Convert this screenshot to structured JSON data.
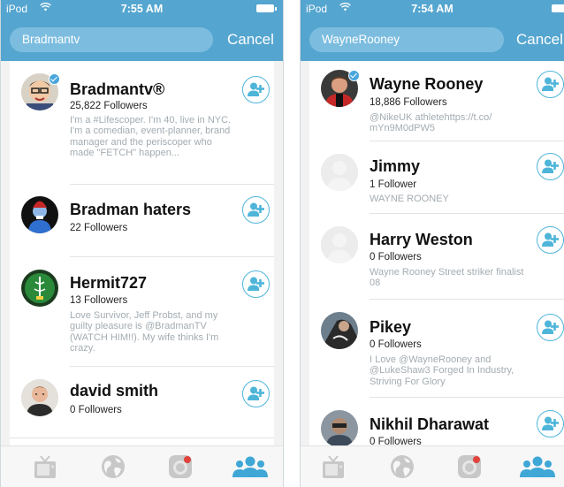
{
  "left": {
    "status": {
      "carrier": "iPod",
      "time": "7:55 AM"
    },
    "search": {
      "query": "Bradmantv",
      "cancel_label": "Cancel"
    },
    "results": [
      {
        "name": "Bradmantv®",
        "followers": "25,822 Followers",
        "verified": true,
        "bio": "I'm a #Lifescoper. I'm 40, live in NYC.  I'm a comedian, event-planner, brand manager and the periscoper who made \"FETCH\" happen..."
      },
      {
        "name": "Bradman haters",
        "followers": "22 Followers",
        "verified": false,
        "bio": ""
      },
      {
        "name": "Hermit727",
        "followers": "13 Followers",
        "verified": false,
        "bio": "Love Survivor, Jeff Probst, and my guilty pleasure is @BradmanTV (WATCH HIM!!). My wife thinks I'm crazy."
      },
      {
        "name": "david smith",
        "followers": "0 Followers",
        "verified": false,
        "bio": ""
      }
    ]
  },
  "right": {
    "status": {
      "carrier": "iPod",
      "time": "7:54 AM"
    },
    "search": {
      "query": "WayneRooney",
      "cancel_label": "Cancel"
    },
    "results": [
      {
        "name": "Wayne Rooney",
        "followers": "18,886 Followers",
        "verified": true,
        "bio": "@NikeUK athletehttps://t.co/ mYn9M0dPW5"
      },
      {
        "name": "Jimmy",
        "followers": "1 Follower",
        "verified": false,
        "bio": "WAYNE ROONEY"
      },
      {
        "name": "Harry Weston",
        "followers": "0 Followers",
        "verified": false,
        "bio": "Wayne Rooney Street striker finalist 08"
      },
      {
        "name": "Pikey",
        "followers": "0 Followers",
        "verified": false,
        "bio": "I Love @WayneRooney and @LukeShaw3 Forged In Industry, Striving For Glory"
      },
      {
        "name": "Nikhil Dharawat",
        "followers": "0 Followers",
        "verified": false,
        "bio": ""
      }
    ]
  },
  "tabs": [
    {
      "icon": "tv-icon"
    },
    {
      "icon": "globe-icon"
    },
    {
      "icon": "camera-broadcast-icon"
    },
    {
      "icon": "people-icon",
      "active": true
    }
  ],
  "colors": {
    "header": "#54a5cf",
    "search_field": "#7cbddf",
    "accent": "#4eb5d9",
    "bio_text": "#a3acb2",
    "tab_inactive": "#c8c8c8",
    "tab_active": "#3fa7d6"
  }
}
